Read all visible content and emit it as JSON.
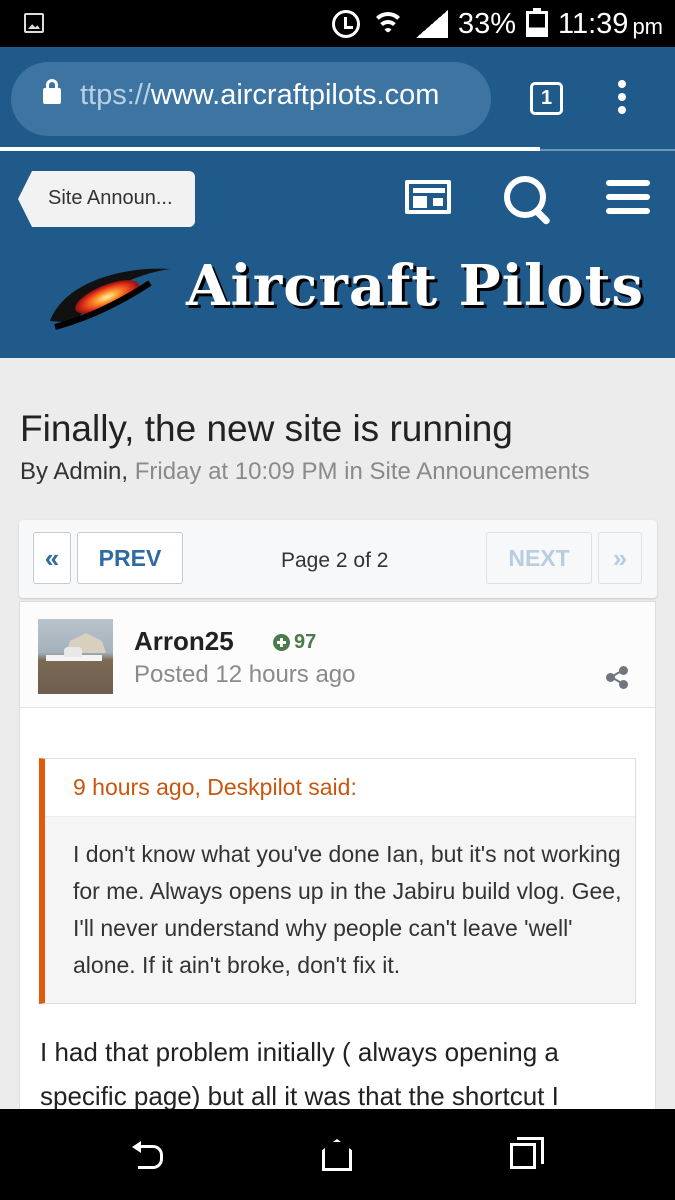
{
  "status_bar": {
    "battery_percent": "33%",
    "time": "11:39",
    "ampm": "pm",
    "battery_level": 0.33
  },
  "browser": {
    "url_scheme": "ttps://",
    "url_host": "www.aircraftpilots.com",
    "tab_count": "1",
    "load_progress": 0.8
  },
  "site_header": {
    "back_label": "Site Announ...",
    "logo_text": "Aircraft Pilots",
    "colors": {
      "brand_blue": "#1f5a8a"
    }
  },
  "article": {
    "title": "Finally, the new site is running",
    "by_author": "By Admin,",
    "date_and_category": "Friday at 10:09 PM in Site Announcements"
  },
  "pagination": {
    "first_label": "«",
    "prev_label": "PREV",
    "page_info": "Page 2 of 2",
    "next_label": "NEXT",
    "last_label": "»"
  },
  "post": {
    "author": "Arron25",
    "reputation": "97",
    "posted": "Posted 12 hours ago",
    "quote": {
      "header": "9 hours ago, Deskpilot said:",
      "body": "I don't know what you've done Ian, but it's not working for me. Always opens up in the Jabiru build vlog. Gee, I'll never understand why people can't leave 'well' alone. If it ain't broke, don't fix it."
    },
    "body": "I had that problem initially ( always opening a specific page) but all it was that the shortcut I"
  },
  "icons": {
    "status": [
      "image-icon",
      "alarm-icon",
      "wifi-icon",
      "signal-icon",
      "battery-icon"
    ],
    "header": [
      "news-icon",
      "search-icon",
      "menu-icon"
    ],
    "nav": [
      "back-icon",
      "home-icon",
      "recents-icon"
    ]
  }
}
